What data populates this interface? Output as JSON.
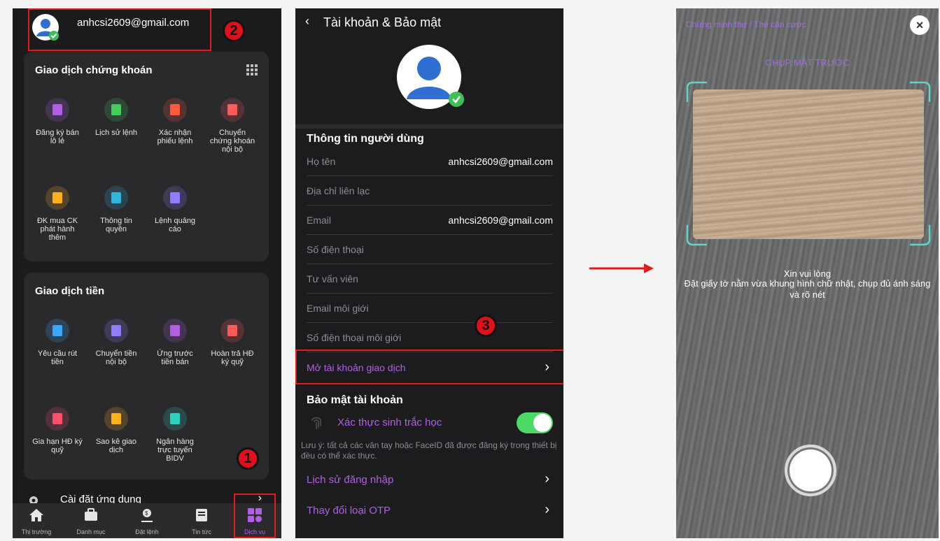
{
  "screen1": {
    "account_email": "anhcsi2609@gmail.com",
    "stock_section": {
      "title": "Giao dịch chứng khoán",
      "items": [
        {
          "label": "Đăng ký bán lô lẻ",
          "icon": "cart-icon",
          "color": "#b160e6"
        },
        {
          "label": "Lịch sử lệnh",
          "icon": "document-icon",
          "color": "#3fcf5a"
        },
        {
          "label": "Xác nhận phiếu lệnh",
          "icon": "receipt-icon",
          "color": "#ff5a3c"
        },
        {
          "label": "Chuyển chứng khoán nội bộ",
          "icon": "transfer-icon",
          "color": "#ff5a5a"
        },
        {
          "label": "ĐK mua CK phát hành thêm",
          "icon": "hand-coin-icon",
          "color": "#ffb020"
        },
        {
          "label": "Thông tin quyền",
          "icon": "medal-icon",
          "color": "#2fb6d6"
        },
        {
          "label": "Lệnh quảng cáo",
          "icon": "megaphone-icon",
          "color": "#8f7cff"
        }
      ]
    },
    "money_section": {
      "title": "Giao dịch tiền",
      "items": [
        {
          "label": "Yêu cầu rút tiền",
          "icon": "wallet-icon",
          "color": "#3aa8ff"
        },
        {
          "label": "Chuyển tiền nội bộ",
          "icon": "transfer-icon",
          "color": "#8f7cff"
        },
        {
          "label": "Ứng trước tiền bán",
          "icon": "hand-coin-icon",
          "color": "#b160e6"
        },
        {
          "label": "Hoàn trả HĐ ký quỹ",
          "icon": "document-icon",
          "color": "#ff5a5a"
        },
        {
          "label": "Gia hạn HĐ ký quỹ",
          "icon": "edit-doc-icon",
          "color": "#ff4f6d"
        },
        {
          "label": "Sao kê giao dịch",
          "icon": "receipt-icon",
          "color": "#ffb020"
        },
        {
          "label": "Ngân hàng trực tuyến BIDV",
          "icon": "bank-icon",
          "color": "#2fd0c0"
        }
      ]
    },
    "settings_label": "Cài đặt ứng dụng",
    "tabs": [
      {
        "label": "Thị trường",
        "icon": "home-icon"
      },
      {
        "label": "Danh mục",
        "icon": "briefcase-icon"
      },
      {
        "label": "Đặt lệnh",
        "icon": "order-icon"
      },
      {
        "label": "Tin tức",
        "icon": "news-icon"
      },
      {
        "label": "Dịch vụ",
        "icon": "services-icon"
      }
    ],
    "badge1": "1",
    "badge2": "2"
  },
  "screen2": {
    "back_title": "Tài khoản & Bảo mật",
    "user_info_title": "Thông tin người dùng",
    "rows": [
      {
        "key": "Họ tên",
        "value": "anhcsi2609@gmail.com"
      },
      {
        "key": "Địa chỉ liên lạc",
        "value": ""
      },
      {
        "key": "Email",
        "value": "anhcsi2609@gmail.com"
      },
      {
        "key": "Số điện thoại",
        "value": ""
      },
      {
        "key": "Tư vấn viên",
        "value": ""
      },
      {
        "key": "Email môi giới",
        "value": ""
      },
      {
        "key": "Số điện thoại môi giới",
        "value": ""
      }
    ],
    "open_account": "Mở tài khoản giao dịch",
    "security_title": "Bảo mật tài khoản",
    "biometric_label": "Xác thực sinh trắc học",
    "biometric_note": "Lưu ý: tất cả các vân tay hoặc FaceID đã được đăng ký trong thiết bị đều có thể xác thực.",
    "login_history": "Lịch sử đăng nhập",
    "change_otp": "Thay đổi loại OTP",
    "badge3": "3"
  },
  "screen3": {
    "top_label": "Chứng minh thư / Thẻ căn cước",
    "capture_label": "CHỤP MẶT TRƯỚC",
    "instruction_1": "Xin vui lòng",
    "instruction_2": "Đặt giấy tờ nằm vừa khung hình chữ nhật, chụp đủ ánh sáng và rõ nét"
  },
  "colors": {
    "accent": "#b160e6",
    "toggle": "#4cd964",
    "highlight": "#e21b1b"
  }
}
